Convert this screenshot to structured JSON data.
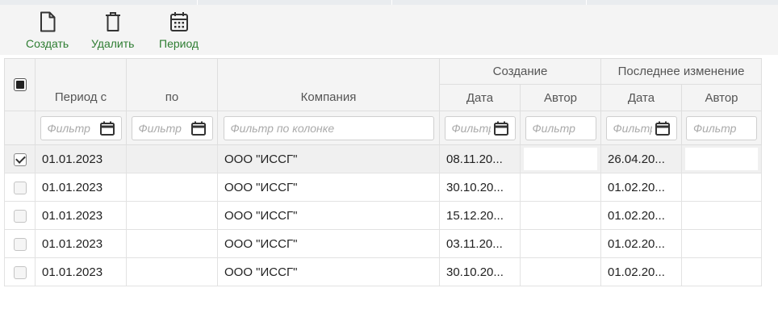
{
  "toolbar": {
    "create_label": "Создать",
    "delete_label": "Удалить",
    "period_label": "Период"
  },
  "colors": {
    "accent": "#2e7d32",
    "header_bg": "#f4f4f4",
    "border": "#dedede"
  },
  "grid": {
    "group_headers": {
      "created": "Создание",
      "modified": "Последнее изменение"
    },
    "columns": {
      "period_from": "Период с",
      "period_to": "по",
      "company": "Компания",
      "created_date": "Дата",
      "created_author": "Автор",
      "modified_date": "Дата",
      "modified_author": "Автор"
    },
    "filters": {
      "period_from": "Фильтр",
      "period_to": "Фильтр",
      "company": "Фильтр по колонке",
      "created_date": "Фильтр",
      "created_author": "Фильтр",
      "modified_date": "Фильтр",
      "modified_author": "Фильтр"
    },
    "rows": [
      {
        "selected": true,
        "period_from": "01.01.2023",
        "period_to": "",
        "company": "ООО \"ИССГ\"",
        "created_date": "08.11.20...",
        "created_author": "",
        "modified_date": "26.04.20...",
        "modified_author": ""
      },
      {
        "selected": false,
        "period_from": "01.01.2023",
        "period_to": "",
        "company": "ООО \"ИССГ\"",
        "created_date": "30.10.20...",
        "created_author": "",
        "modified_date": "01.02.20...",
        "modified_author": ""
      },
      {
        "selected": false,
        "period_from": "01.01.2023",
        "period_to": "",
        "company": "ООО \"ИССГ\"",
        "created_date": "15.12.20...",
        "created_author": "",
        "modified_date": "01.02.20...",
        "modified_author": ""
      },
      {
        "selected": false,
        "period_from": "01.01.2023",
        "period_to": "",
        "company": "ООО \"ИССГ\"",
        "created_date": "03.11.20...",
        "created_author": "",
        "modified_date": "01.02.20...",
        "modified_author": ""
      },
      {
        "selected": false,
        "period_from": "01.01.2023",
        "period_to": "",
        "company": "ООО \"ИССГ\"",
        "created_date": "30.10.20...",
        "created_author": "",
        "modified_date": "01.02.20...",
        "modified_author": ""
      }
    ]
  }
}
